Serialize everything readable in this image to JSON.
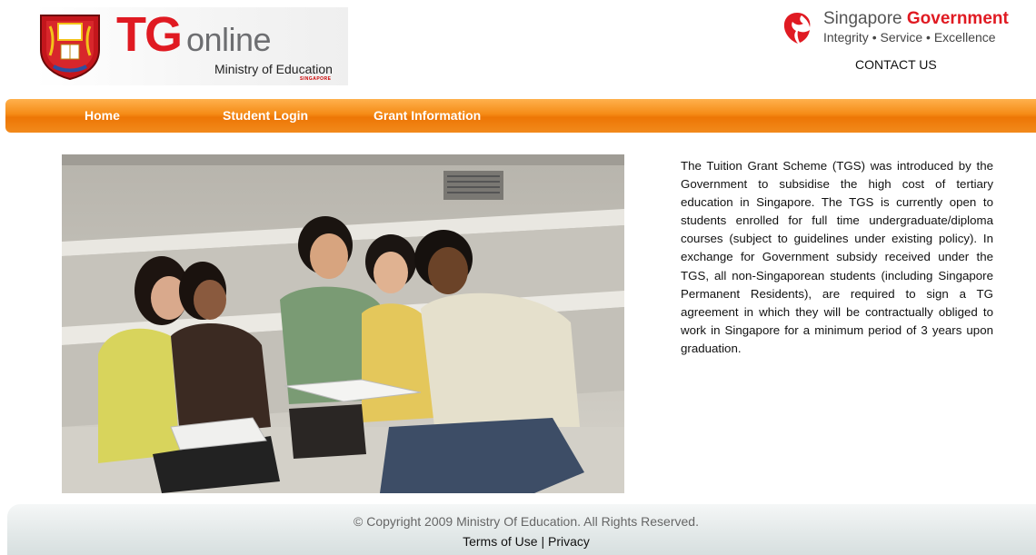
{
  "header": {
    "logo": {
      "tg": "TG",
      "online": "online",
      "ministry": "Ministry of Education",
      "ministry_sub": "SINGAPORE"
    },
    "gov": {
      "name_part1": "Singapore",
      "name_part2": "Government",
      "tagline": "Integrity • Service • Excellence"
    },
    "contact_label": "CONTACT US"
  },
  "nav": {
    "items": [
      {
        "label": "Home"
      },
      {
        "label": "Student Login"
      },
      {
        "label": "Grant Information"
      }
    ]
  },
  "main": {
    "intro": "The Tuition Grant Scheme (TGS) was introduced by the Government to subsidise the high cost of tertiary education in Singapore. The TGS is currently open to students enrolled for full time undergraduate/diploma courses (subject to guidelines under existing policy). In exchange for Government subsidy received under the TGS, all non-Singaporean students (including Singapore Permanent Residents), are required to sign a TG agreement in which they will be contractually obliged to work in Singapore for a minimum period of 3 years upon graduation."
  },
  "footer": {
    "copyright": "© Copyright 2009 Ministry Of Education. All Rights Reserved.",
    "terms_label": "Terms of Use",
    "separator": "|",
    "privacy_label": "Privacy"
  },
  "colors": {
    "brand_red": "#e01a22",
    "nav_orange": "#f58b16",
    "footer_gray": "#e2e8e8"
  },
  "icons": [
    "moe-crest-icon",
    "singapore-lion-icon"
  ]
}
